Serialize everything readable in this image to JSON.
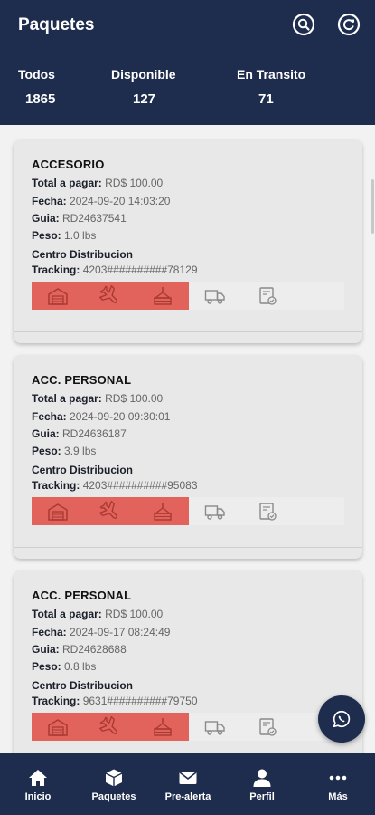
{
  "header": {
    "title": "Paquetes",
    "search_icon": "search-icon",
    "refresh_icon": "refresh-icon"
  },
  "stats": [
    {
      "label": "Todos",
      "value": "1865"
    },
    {
      "label": "Disponible",
      "value": "127"
    },
    {
      "label": "En Transito",
      "value": "71"
    }
  ],
  "packages": [
    {
      "category": "ACCESORIO",
      "total_label": "Total a pagar:",
      "total_value": "RD$ 100.00",
      "fecha_label": "Fecha:",
      "fecha_value": "2024-09-20 14:03:20",
      "guia_label": "Guia:",
      "guia_value": "RD24637541",
      "peso_label": "Peso:",
      "peso_value": "1.0  lbs",
      "centro": "Centro Distribucion",
      "tracking_label": "Tracking:",
      "tracking_value": "4203##########78129",
      "status_completed_steps": 3,
      "status_total_steps": 5
    },
    {
      "category": "ACC. PERSONAL",
      "total_label": "Total a pagar:",
      "total_value": "RD$ 100.00",
      "fecha_label": "Fecha:",
      "fecha_value": "2024-09-20 09:30:01",
      "guia_label": "Guia:",
      "guia_value": "RD24636187",
      "peso_label": "Peso:",
      "peso_value": "3.9  lbs",
      "centro": "Centro Distribucion",
      "tracking_label": "Tracking:",
      "tracking_value": "4203##########95083",
      "status_completed_steps": 3,
      "status_total_steps": 5
    },
    {
      "category": "ACC. PERSONAL",
      "total_label": "Total a pagar:",
      "total_value": "RD$ 100.00",
      "fecha_label": "Fecha:",
      "fecha_value": "2024-09-17 08:24:49",
      "guia_label": "Guia:",
      "guia_value": "RD24628688",
      "peso_label": "Peso:",
      "peso_value": "0.8  lbs",
      "centro": "Centro Distribucion",
      "tracking_label": "Tracking:",
      "tracking_value": "9631##########79750",
      "status_completed_steps": 3,
      "status_total_steps": 5
    }
  ],
  "status_icons": [
    "warehouse-icon",
    "plane-icon",
    "hook-icon",
    "truck-icon",
    "delivered-icon"
  ],
  "fab_icon": "whatsapp-icon",
  "nav": [
    {
      "label": "Inicio",
      "icon": "home-icon"
    },
    {
      "label": "Paquetes",
      "icon": "package-icon"
    },
    {
      "label": "Pre-alerta",
      "icon": "mail-icon"
    },
    {
      "label": "Perfil",
      "icon": "user-icon"
    },
    {
      "label": "Más",
      "icon": "more-icon"
    }
  ],
  "colors": {
    "primary": "#1e2d4d",
    "status_completed": "#e2635b",
    "status_pending": "#ededed",
    "card": "#e8e8e8"
  }
}
